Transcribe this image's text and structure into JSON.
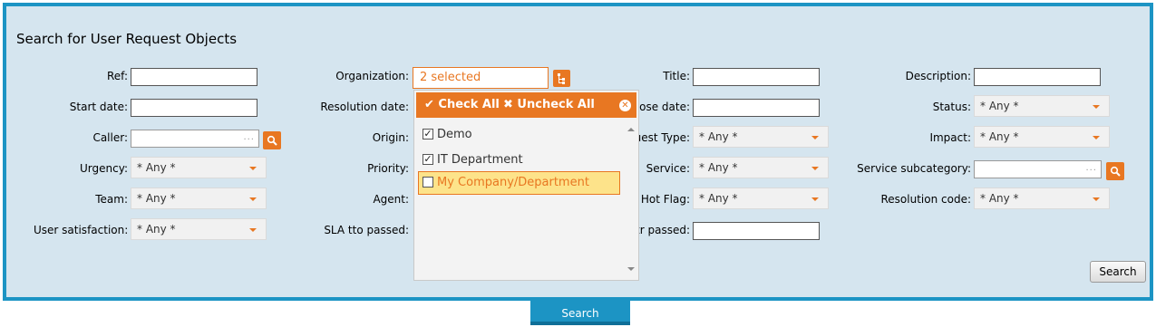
{
  "form": {
    "title": "Search for User Request Objects",
    "labels": {
      "ref": "Ref:",
      "organization": "Organization:",
      "title": "Title:",
      "description": "Description:",
      "start_date": "Start date:",
      "resolution_date": "Resolution date:",
      "close_date": "Close date:",
      "status": "Status:",
      "caller": "Caller:",
      "origin": "Origin:",
      "request_type": "uest Type:",
      "impact": "Impact:",
      "urgency": "Urgency:",
      "priority": "Priority:",
      "service": "Service:",
      "service_subcategory": "Service subcategory:",
      "team": "Team:",
      "agent": "Agent:",
      "hot_flag": "Hot Flag:",
      "resolution_code": "Resolution code:",
      "user_satisfaction": "User satisfaction:",
      "sla_tto_passed": "SLA tto passed:",
      "sla_ttr_passed": "ctr passed:"
    },
    "any_value": "* Any *",
    "lookup_dots": "...",
    "organization_selected": "2 selected",
    "search_button": "Search"
  },
  "dropdown": {
    "check_all": "Check All",
    "uncheck_all": "Uncheck All",
    "options": [
      {
        "label": "Demo",
        "checked": true
      },
      {
        "label": "IT Department",
        "checked": true
      },
      {
        "label": "My Company/Department",
        "checked": false
      }
    ]
  },
  "bottom_tab": {
    "label": "Search"
  },
  "colors": {
    "accent": "#e87722",
    "frame": "#1c94c4",
    "panel_bg": "#d5e5ef",
    "highlight": "#fde38a"
  }
}
